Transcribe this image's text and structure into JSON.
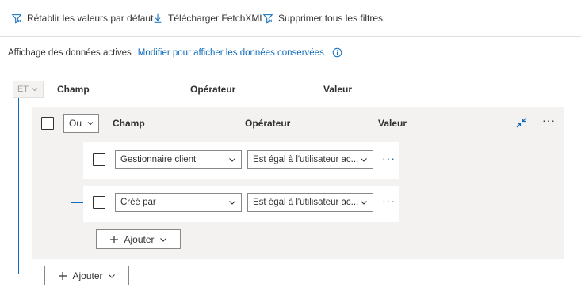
{
  "toolbar": {
    "reset_label": "Rétablir les valeurs par défaut",
    "download_label": "Télécharger FetchXML",
    "clear_label": "Supprimer tous les filtres"
  },
  "info": {
    "status_text": "Affichage des données actives",
    "modify_link": "Modifier pour afficher les données conservées"
  },
  "root_group": {
    "operator": "ET",
    "headers": {
      "field": "Champ",
      "operator": "Opérateur",
      "value": "Valeur"
    },
    "add_label": "Ajouter"
  },
  "inner_group": {
    "operator": "Ou",
    "headers": {
      "field": "Champ",
      "operator": "Opérateur",
      "value": "Valeur"
    },
    "rows": [
      {
        "field": "Gestionnaire client",
        "operator": "Est égal à l'utilisateur ac..."
      },
      {
        "field": "Créé par",
        "operator": "Est égal à l'utilisateur ac..."
      }
    ],
    "add_label": "Ajouter"
  },
  "colors": {
    "accent": "#0f6cbd",
    "group_bg": "#f3f2f1",
    "border": "#8a8886"
  }
}
